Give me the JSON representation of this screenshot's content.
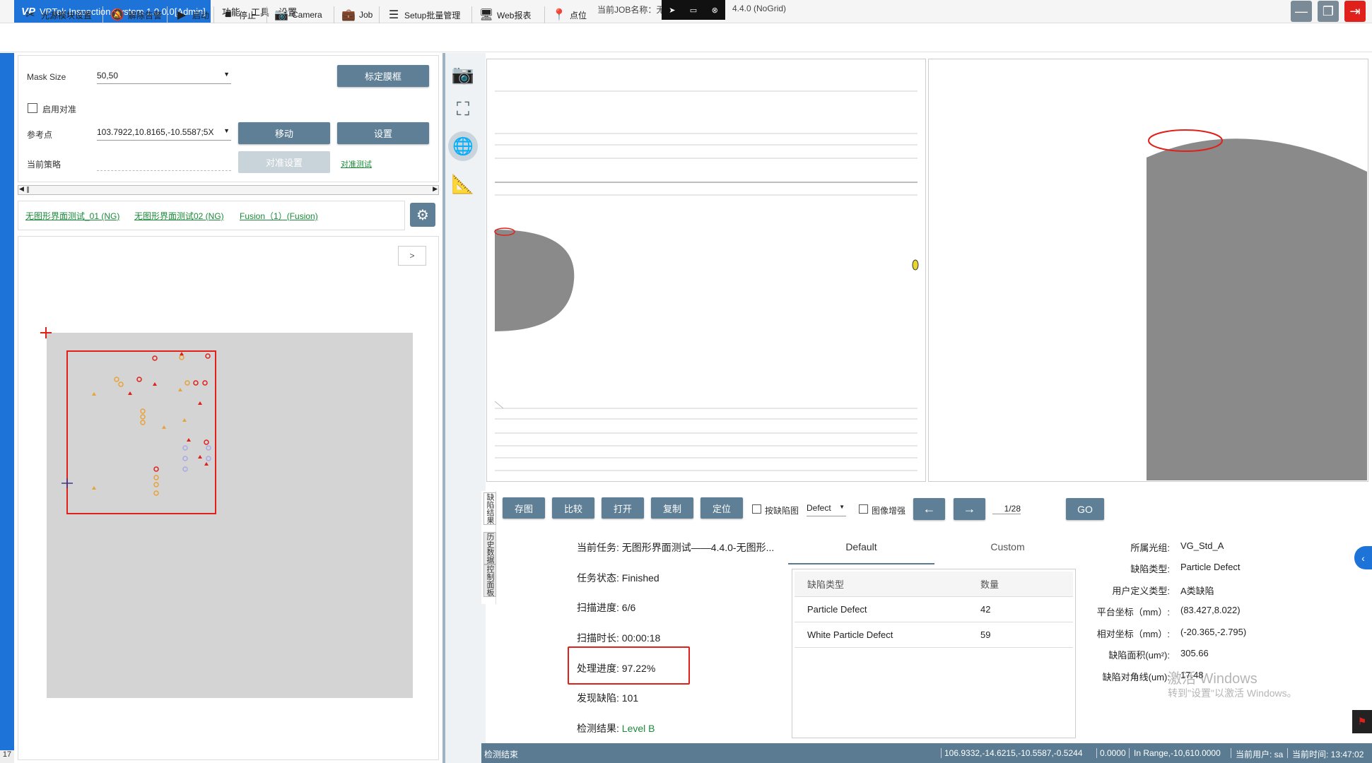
{
  "app": {
    "title": "VPTek Inspection System 1.0.0.0[Admin]",
    "logo": "VP"
  },
  "menu": [
    "功能",
    "工具",
    "设置"
  ],
  "job_label": "当前JOB名称：无",
  "job_suffix": "4.4.0 (NoGrid)",
  "toolbar": {
    "light_module": "光源模块设置",
    "clear_alarm": "解除告警",
    "start": "启动",
    "stop": "停止",
    "camera": "Camera",
    "job": "Job",
    "setup_batch": "Setup批量管理",
    "web_report": "Web报表",
    "position": "点位"
  },
  "left": {
    "mask_size_label": "Mask Size",
    "mask_size_value": "50,50",
    "calibrate_mask_button": "标定膜框",
    "enable_align_label": "启用对准",
    "ref_point_label": "参考点",
    "ref_point_value": "103.7922,10.8165,-10.5587;5X",
    "move_button": "移动",
    "set_button": "设置",
    "current_strategy_label": "当前策略",
    "align_setup_button": "对准设置",
    "align_test_link": "对准测试",
    "tabs": [
      "无图形界面测试_01 (NG)",
      "无图形界面测试02 (NG)",
      "Fusion（1）(Fusion)"
    ],
    "expand_button": ">"
  },
  "controls": {
    "save_image": "存图",
    "compare": "比较",
    "open": "打开",
    "copy": "复制",
    "locate": "定位",
    "by_defect_map_label": "按缺陷图",
    "defect_select": "Defect",
    "image_enhance_label": "图像增强",
    "prev": "←",
    "next": "→",
    "page": "1/28",
    "go": "GO"
  },
  "side_tabs": [
    "缺陷结果",
    "历史数据",
    "控制面板"
  ],
  "task": {
    "current_task_label": "当前任务:",
    "current_task_value": "无图形界面测试——4.4.0-无图形...",
    "status_label": "任务状态:",
    "status_value": "Finished",
    "scan_progress_label": "扫描进度:",
    "scan_progress_value": "6/6",
    "scan_duration_label": "扫描时长:",
    "scan_duration_value": "00:00:18",
    "process_progress_label": "处理进度:",
    "process_progress_value": "97.22%",
    "defects_found_label": "发现缺陷:",
    "defects_found_value": "101",
    "result_label": "检测结果:",
    "result_value": "Level B"
  },
  "defect_tabs": [
    "Default",
    "Custom"
  ],
  "defect_table": {
    "headers": [
      "缺陷类型",
      "数量"
    ],
    "rows": [
      {
        "type": "Particle Defect",
        "count": "42"
      },
      {
        "type": "White Particle Defect",
        "count": "59"
      }
    ]
  },
  "defect_info": {
    "light_group_label": "所属光组:",
    "light_group_value": "VG_Std_A",
    "defect_type_label": "缺陷类型:",
    "defect_type_value": "Particle Defect",
    "user_type_label": "用户定义类型:",
    "user_type_value": "A类缺陷",
    "platform_coord_label": "平台坐标（mm）:",
    "platform_coord_value": "(83.427,8.022)",
    "relative_coord_label": "相对坐标（mm）:",
    "relative_coord_value": "(-20.365,-2.795)",
    "area_label": "缺陷面积(um²):",
    "area_value": "305.66",
    "diagonal_label": "缺陷对角线(um):",
    "diagonal_value": "17.48"
  },
  "watermark": {
    "line1": "激活 Windows",
    "line2": "转到\"设置\"以激活 Windows。"
  },
  "status": {
    "left": "检测结束",
    "coords": "106.9332,-14.6215,-10.5587,-0.5244",
    "value": "0.0000",
    "range": "In Range,-10,610.0000",
    "user": "当前用户: sa",
    "time": "当前时间: 13:47:02"
  },
  "edge_number": "17",
  "colors": {
    "accent": "#1e73d8",
    "button": "#5e7f95",
    "status_bar": "#5a7b91",
    "highlight": "#e0201b"
  }
}
